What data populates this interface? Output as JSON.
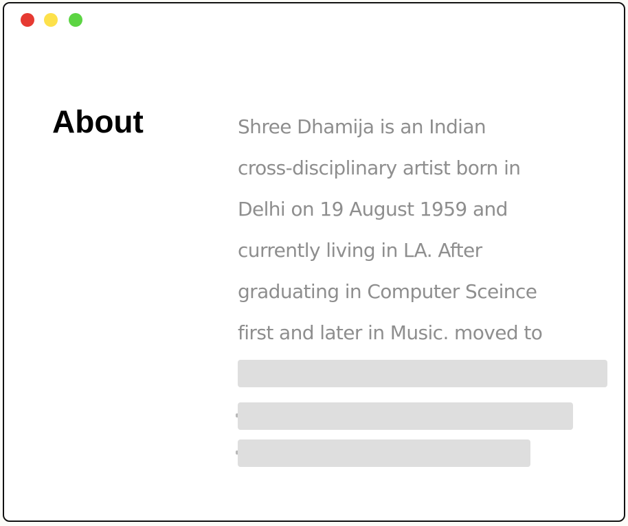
{
  "window": {
    "controls": [
      {
        "name": "close",
        "color": "#e63a32"
      },
      {
        "name": "minimize",
        "color": "#fde14b"
      },
      {
        "name": "zoom",
        "color": "#5cd443"
      }
    ]
  },
  "about": {
    "heading": "About",
    "lines": [
      "Shree Dhamija is an Indian",
      "cross-disciplinary artist born in",
      "Delhi on 19 August 1959 and",
      "currently living in LA. After",
      "graduating in Computer Sceince",
      "first and later in Music. moved to"
    ],
    "placeholder_lines": 3
  },
  "colors": {
    "heading": "#000000",
    "body_text": "#8e8e8e",
    "skeleton": "#dedede",
    "border": "#111111"
  }
}
